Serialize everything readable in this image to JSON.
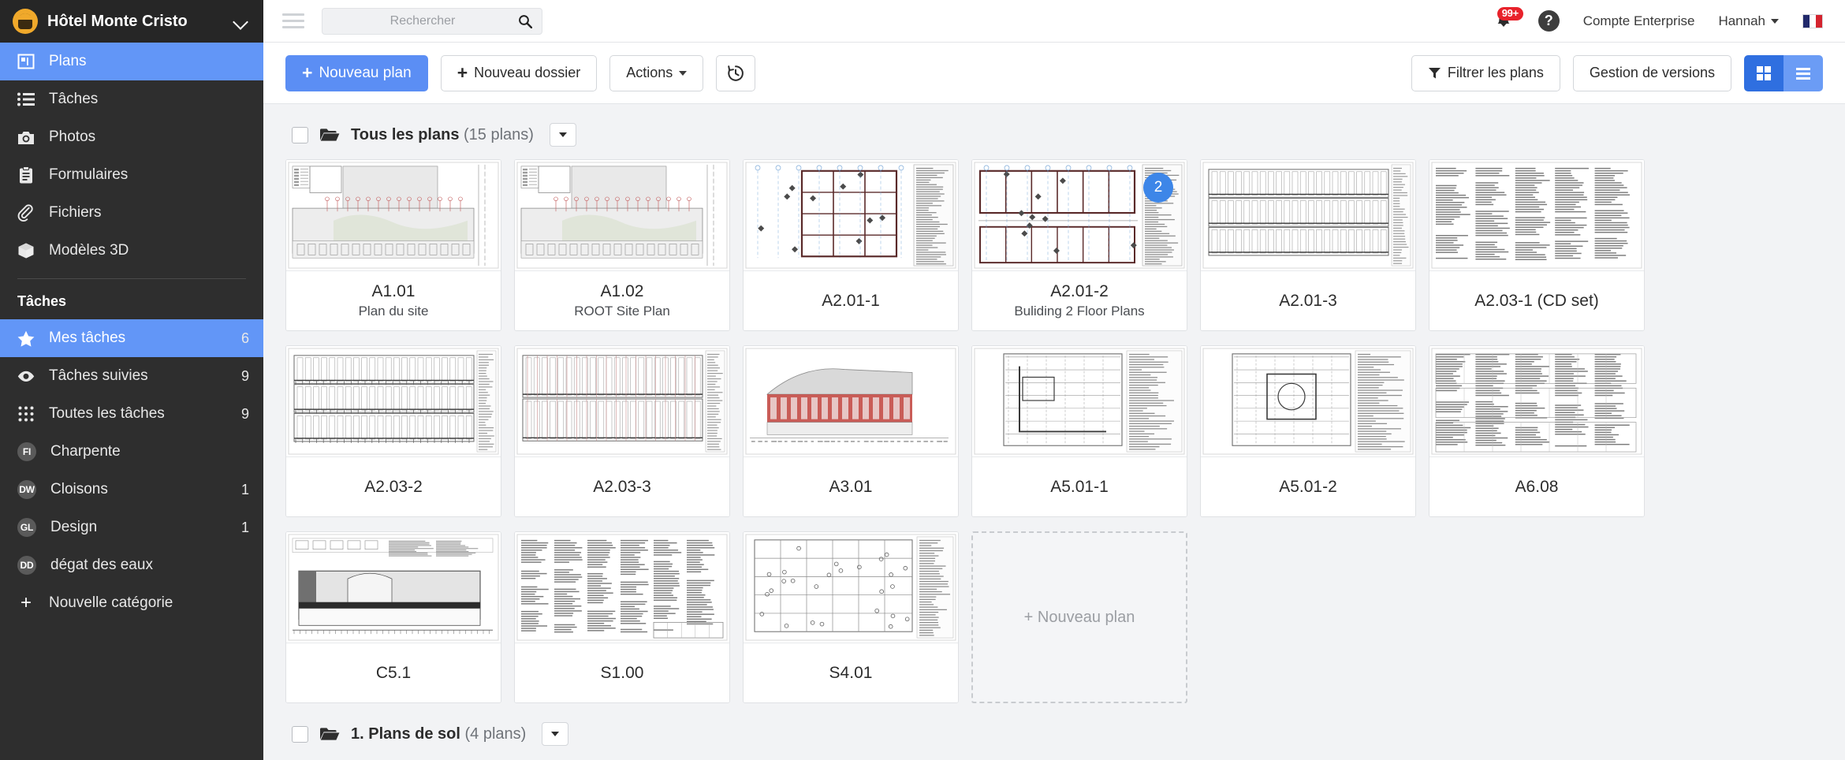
{
  "sidebar": {
    "brand": {
      "name": "Hôtel Monte Cristo",
      "caret": "chevron-down"
    },
    "nav": [
      {
        "label": "Plans",
        "icon": "plan-icon",
        "active": true
      },
      {
        "label": "Tâches",
        "icon": "list-icon",
        "active": false
      },
      {
        "label": "Photos",
        "icon": "camera-icon",
        "active": false
      },
      {
        "label": "Formulaires",
        "icon": "clipboard-icon",
        "active": false
      },
      {
        "label": "Fichiers",
        "icon": "paperclip-icon",
        "active": false
      },
      {
        "label": "Modèles 3D",
        "icon": "cube-icon",
        "active": false
      }
    ],
    "section_title": "Tâches",
    "tasks": [
      {
        "label": "Mes tâches",
        "count": "6",
        "icon": "star-icon",
        "active": true,
        "avatar": ""
      },
      {
        "label": "Tâches suivies",
        "count": "9",
        "icon": "eye-icon",
        "active": false,
        "avatar": ""
      },
      {
        "label": "Toutes les tâches",
        "count": "9",
        "icon": "grid-dots-icon",
        "active": false,
        "avatar": ""
      },
      {
        "label": "Charpente",
        "count": "",
        "icon": "avatar",
        "active": false,
        "avatar": "FI"
      },
      {
        "label": "Cloisons",
        "count": "1",
        "icon": "avatar",
        "active": false,
        "avatar": "DW"
      },
      {
        "label": "Design",
        "count": "1",
        "icon": "avatar",
        "active": false,
        "avatar": "GL"
      },
      {
        "label": "dégat des eaux",
        "count": "",
        "icon": "avatar",
        "active": false,
        "avatar": "DD"
      },
      {
        "label": "Nouvelle catégorie",
        "count": "",
        "icon": "plus-icon",
        "active": false,
        "avatar": ""
      }
    ]
  },
  "topbar": {
    "menu_icon": "hamburger-icon",
    "search": {
      "placeholder": "Rechercher",
      "value": "",
      "icon": "search-icon"
    },
    "notifications": {
      "badge": "99+",
      "icon": "bell-icon"
    },
    "help": {
      "label": "?",
      "icon": "help-icon"
    },
    "account": "Compte Enterprise",
    "user": "Hannah",
    "language_flag": "fr-flag-icon"
  },
  "toolbar": {
    "new_plan": "Nouveau plan",
    "new_folder": "Nouveau dossier",
    "actions": "Actions",
    "history_icon": "history-clock-icon",
    "filter": "Filtrer les plans",
    "versions": "Gestion de versions",
    "view_grid_icon": "grid-view-icon",
    "view_list_icon": "list-view-icon",
    "active_view": "grid",
    "accent_color": "#5b8ef4",
    "view_grid_color": "#2f6fe0",
    "view_list_color": "#6b9cf5"
  },
  "folders": [
    {
      "name": "Tous les plans",
      "count": "(15 plans)",
      "expanded": true
    },
    {
      "name": "1. Plans de sol",
      "count": "(4 plans)",
      "expanded": false
    }
  ],
  "plans": [
    {
      "title": "A1.01",
      "sub": "Plan du site",
      "badge": "",
      "thumb": "site-plan"
    },
    {
      "title": "A1.02",
      "sub": "ROOT Site Plan",
      "badge": "",
      "thumb": "site-plan"
    },
    {
      "title": "A2.01-1",
      "sub": "",
      "badge": "",
      "thumb": "floor-plan"
    },
    {
      "title": "A2.01-2",
      "sub": "Buliding 2 Floor Plans",
      "badge": "2",
      "thumb": "floor-plan-wide"
    },
    {
      "title": "A2.01-3",
      "sub": "",
      "badge": "",
      "thumb": "elevation"
    },
    {
      "title": "A2.03-1 (CD set)",
      "sub": "",
      "badge": "",
      "thumb": "schedule"
    },
    {
      "title": "A2.03-2",
      "sub": "",
      "badge": "",
      "thumb": "elevation2"
    },
    {
      "title": "A2.03-3",
      "sub": "",
      "badge": "",
      "thumb": "elevation3"
    },
    {
      "title": "A3.01",
      "sub": "",
      "badge": "",
      "thumb": "render"
    },
    {
      "title": "A5.01-1",
      "sub": "",
      "badge": "",
      "thumb": "detail"
    },
    {
      "title": "A5.01-2",
      "sub": "",
      "badge": "",
      "thumb": "detail2"
    },
    {
      "title": "A6.08",
      "sub": "",
      "badge": "",
      "thumb": "schedule2"
    },
    {
      "title": "C5.1",
      "sub": "",
      "badge": "",
      "thumb": "section"
    },
    {
      "title": "S1.00",
      "sub": "",
      "badge": "",
      "thumb": "text-sheet"
    },
    {
      "title": "S4.01",
      "sub": "",
      "badge": "",
      "thumb": "struct"
    }
  ],
  "new_plan_placeholder": "+ Nouveau plan"
}
